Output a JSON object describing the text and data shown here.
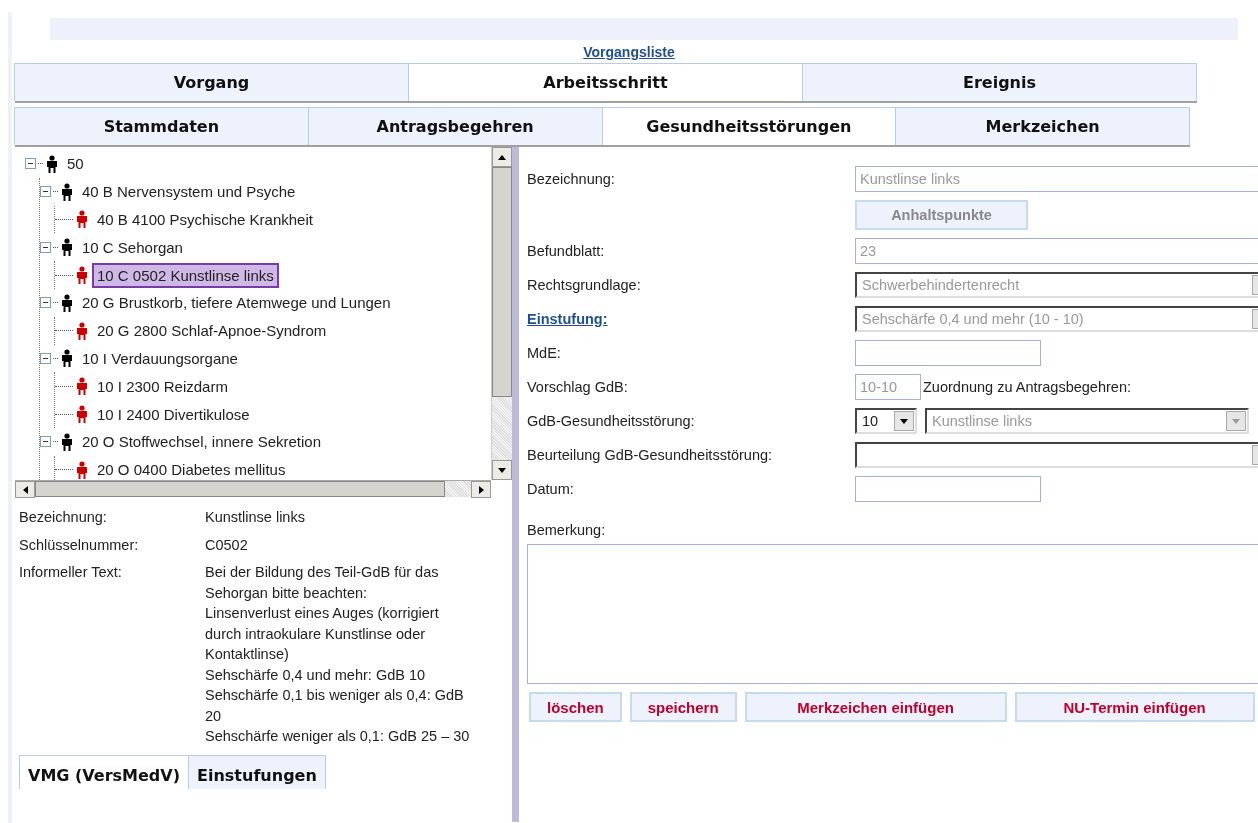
{
  "top_link": "Vorgangsliste",
  "tab_rows": [
    [
      {
        "label": "Vorgang",
        "selected": false
      },
      {
        "label": "Arbeitsschritt",
        "selected": true
      },
      {
        "label": "Ereignis",
        "selected": false
      }
    ],
    [
      {
        "label": "Stammdaten",
        "selected": false
      },
      {
        "label": "Antragsbegehren",
        "selected": false
      },
      {
        "label": "Gesundheitsstörungen",
        "selected": true
      },
      {
        "label": "Merkzeichen",
        "selected": false
      }
    ]
  ],
  "tree": [
    {
      "label": "50",
      "kind": "group",
      "expanded": true,
      "selected": false,
      "children": [
        {
          "label": "40 B Nervensystem und Psyche",
          "kind": "group",
          "expanded": true,
          "selected": false,
          "children": [
            {
              "label": "40 B 4100 Psychische Krankheit",
              "kind": "item",
              "selected": false
            }
          ]
        },
        {
          "label": "10 C Sehorgan",
          "kind": "group",
          "expanded": true,
          "selected": false,
          "children": [
            {
              "label": "10 C 0502 Kunstlinse links",
              "kind": "item",
              "selected": true
            }
          ]
        },
        {
          "label": "20 G Brustkorb, tiefere Atemwege und Lungen",
          "kind": "group",
          "expanded": true,
          "selected": false,
          "children": [
            {
              "label": "20 G 2800 Schlaf-Apnoe-Syndrom",
              "kind": "item",
              "selected": false
            }
          ]
        },
        {
          "label": "10 I Verdauungsorgane",
          "kind": "group",
          "expanded": true,
          "selected": false,
          "children": [
            {
              "label": "10 I 2300 Reizdarm",
              "kind": "item",
              "selected": false
            },
            {
              "label": "10 I 2400 Divertikulose",
              "kind": "item",
              "selected": false
            }
          ]
        },
        {
          "label": "20 O Stoffwechsel, innere Sekretion",
          "kind": "group",
          "expanded": true,
          "selected": false,
          "children": [
            {
              "label": "20 O 0400 Diabetes mellitus",
              "kind": "item",
              "selected": false
            }
          ]
        }
      ]
    }
  ],
  "info": [
    {
      "label": "Bezeichnung:",
      "lines": [
        "Kunstlinse links"
      ]
    },
    {
      "label": "Schlüsselnummer:",
      "lines": [
        "C0502"
      ]
    },
    {
      "label": "Informeller Text:",
      "lines": [
        "Bei der Bildung des Teil-GdB für das Sehorgan bitte beachten:",
        "Linsenverlust eines Auges (korrigiert durch intraokulare Kunstlinse oder Kontaktlinse)",
        "Sehschärfe 0,4 und mehr: GdB 10",
        "Sehschärfe 0,1 bis weniger als 0,4: GdB 20",
        "Sehschärfe weniger als 0,1: GdB 25 – 30"
      ]
    }
  ],
  "bottom_tabs": [
    {
      "label": "VMG (VersMedV)",
      "selected": true
    },
    {
      "label": "Einstufungen",
      "selected": false
    }
  ],
  "form": [
    {
      "label": "Bezeichnung:",
      "link": false,
      "kind": "text",
      "value": "Kunstlinse links",
      "disabled": true
    },
    {
      "kind": "button",
      "button": "Anhaltspunkte",
      "disabled": true
    },
    {
      "label": "Befundblatt:",
      "link": false,
      "kind": "text",
      "value": "23",
      "disabled": true
    },
    {
      "label": "Rechtsgrundlage:",
      "link": false,
      "kind": "select",
      "value": "Schwerbehindertenrecht",
      "disabled": true
    },
    {
      "label": "Einstufung:",
      "link": true,
      "kind": "select",
      "value": "Sehschärfe 0,4 und mehr (10 - 10)",
      "disabled": true
    },
    {
      "label": "MdE:",
      "link": false,
      "kind": "short"
    },
    {
      "label": "Vorschlag GdB:",
      "link": false,
      "kind": "mini",
      "value": "10-10",
      "disabled": true,
      "note": "Zuordnung zu Antragsbegehren:"
    },
    {
      "label": "GdB-Gesundheitsstörung:",
      "link": false,
      "kind": "select_pair",
      "value": "10",
      "value_2": "Kunstlinse links",
      "disabled_2": true
    },
    {
      "label": "Beurteilung GdB-Gesundheitsstörung:",
      "link": false,
      "kind": "select"
    },
    {
      "label": "Datum:",
      "link": false,
      "kind": "short"
    }
  ],
  "remark_label": "Bemerkung:",
  "actions": [
    "löschen",
    "speichern",
    "Merkzeichen einfügen",
    "NU-Termin einfügen"
  ]
}
